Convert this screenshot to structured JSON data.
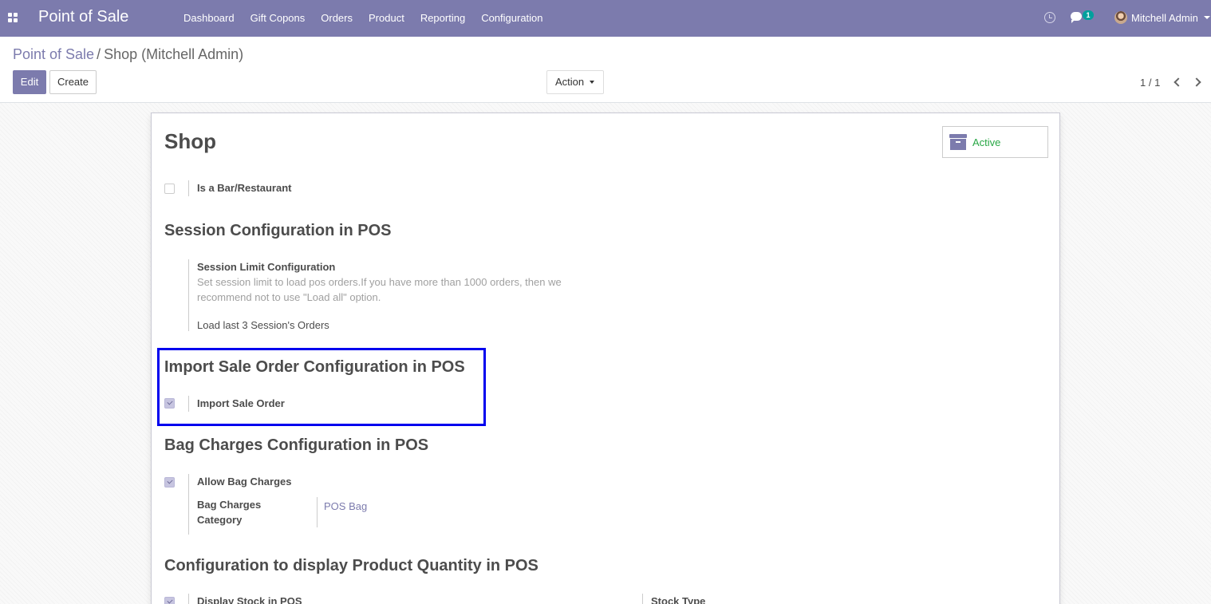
{
  "navbar": {
    "app_title": "Point of Sale",
    "menu": [
      "Dashboard",
      "Gift Copons",
      "Orders",
      "Product",
      "Reporting",
      "Configuration"
    ],
    "messages_badge": "1",
    "user_name": "Mitchell Admin",
    "background_color": "#7c7bad"
  },
  "control_panel": {
    "breadcrumb_parent": "Point of Sale",
    "breadcrumb_sep": "/",
    "breadcrumb_current": "Shop (Mitchell Admin)",
    "edit_label": "Edit",
    "create_label": "Create",
    "action_label": "Action",
    "pager": "1 / 1"
  },
  "form": {
    "title": "Shop",
    "active_label": "Active",
    "is_bar_restaurant_label": "Is a Bar/Restaurant",
    "is_bar_restaurant_checked": false,
    "session_section_title": "Session Configuration in POS",
    "session_limit_label": "Session Limit Configuration",
    "session_limit_help": "Set session limit to load pos orders.If you have more than 1000 orders, then we recommend not to use \"Load all\" option.",
    "session_limit_value": "Load last 3 Session's Orders",
    "import_section_title": "Import Sale Order Configuration in POS",
    "import_sale_order_label": "Import Sale Order",
    "import_sale_order_checked": true,
    "bag_section_title": "Bag Charges Configuration in POS",
    "allow_bag_charges_label": "Allow Bag Charges",
    "allow_bag_charges_checked": true,
    "bag_category_label_line1": "Bag Charges",
    "bag_category_label_line2": "Category",
    "bag_category_value": "POS Bag",
    "quantity_section_title": "Configuration to display Product Quantity in POS",
    "display_stock_label": "Display Stock in POS",
    "display_stock_checked": true,
    "stock_type_label": "Stock Type"
  },
  "colors": {
    "accent": "#7c7bad",
    "active_green": "#28a745",
    "highlight_border": "#0000ee"
  }
}
